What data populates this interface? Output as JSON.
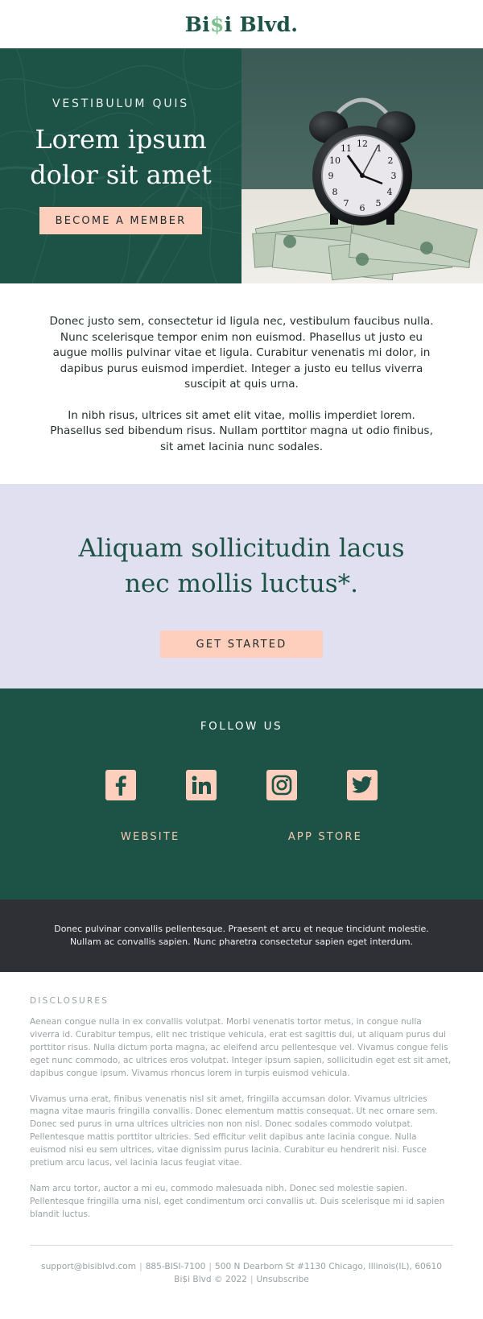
{
  "header": {
    "logo_pre": "Bi",
    "logo_dollar": "$",
    "logo_post": "i Blvd."
  },
  "hero": {
    "eyebrow": "VESTIBULUM QUIS",
    "title_line1": "Lorem ipsum",
    "title_line2": "dolor sit amet",
    "cta_label": "BECOME A MEMBER",
    "image_subject": "alarm-clock-on-money"
  },
  "intro": {
    "paragraphs": [
      "Donec justo sem, consectetur id ligula nec, vestibulum faucibus nulla. Nunc scelerisque tempor enim non euismod. Phasellus ut justo eu augue mollis pulvinar vitae et ligula. Curabitur venenatis mi dolor, in dapibus purus euismod imperdiet. Integer a justo eu tellus viverra suscipit at quis urna.",
      "In nibh risus, ultrices sit amet elit vitae, mollis imperdiet lorem. Phasellus sed bibendum risus. Nullam porttitor magna ut odio finibus, sit amet lacinia nunc sodales."
    ]
  },
  "promo": {
    "title_line1": "Aliquam sollicitudin lacus",
    "title_line2": "nec mollis luctus*.",
    "cta_label": "GET STARTED"
  },
  "follow": {
    "title": "FOLLOW US",
    "social": [
      {
        "icon": "facebook-icon"
      },
      {
        "icon": "linkedin-icon"
      },
      {
        "icon": "instagram-icon"
      },
      {
        "icon": "twitter-icon"
      }
    ],
    "links": {
      "website": "WEBSITE",
      "app_store": "APP STORE"
    }
  },
  "notice": {
    "line1": "Donec pulvinar convallis pellentesque. Praesent et arcu et neque tincidunt molestie.",
    "line2": "Nullam ac convallis sapien. Nunc pharetra consectetur sapien eget interdum."
  },
  "disclosures": {
    "title": "DISCLOSURES",
    "paragraphs": [
      "Aenean congue nulla in ex convallis volutpat. Morbi venenatis tortor metus, in congue nulla viverra id. Curabitur tempus, elit nec tristique vehicula, erat est sagittis dui, ut aliquam purus dui porttitor risus. Nulla dictum porta magna, ac eleifend arcu pellentesque vel. Vivamus congue felis eget nunc commodo, ac ultrices eros volutpat. Integer ipsum sapien, sollicitudin eget est sit amet, dapibus congue ipsum. Vivamus rhoncus lorem in turpis euismod vehicula.",
      "Vivamus urna erat, finibus venenatis nisl sit amet, fringilla accumsan dolor. Vivamus ultricies magna vitae mauris fringilla convallis. Donec elementum mattis consequat. Ut nec ornare sem. Donec sed purus in urna ultrices ultricies non non nisl. Donec sodales commodo volutpat. Pellentesque mattis porttitor ultricies. Sed efficitur velit dapibus ante lacinia congue. Nulla euismod nisi eu sem ultrices, vitae dignissim purus lacinia. Curabitur eu hendrerit nisi. Fusce pretium arcu lacus, vel lacinia lacus feugiat vitae.",
      "Nam arcu tortor, auctor a mi eu, commodo malesuada nibh. Donec sed molestie sapien. Pellentesque fringilla urna nisl, eget condimentum orci convallis ut. Duis scelerisque mi id sapien blandit luctus."
    ]
  },
  "contact": {
    "email": "support@bisiblvd.com",
    "phone": "885-BISI-7100",
    "address": "500 N Dearborn St #1130 Chicago, Illinois(IL), 60610",
    "copyright": "Bi$i Blvd © 2022",
    "unsubscribe": "Unsubscribe",
    "separator": "|"
  },
  "colors": {
    "brand_green": "#1d5346",
    "peach": "#fecfbd",
    "lavender": "#e1e0f1",
    "dark_bar": "#2e3035",
    "logo_dollar": "#7bbd8c"
  }
}
